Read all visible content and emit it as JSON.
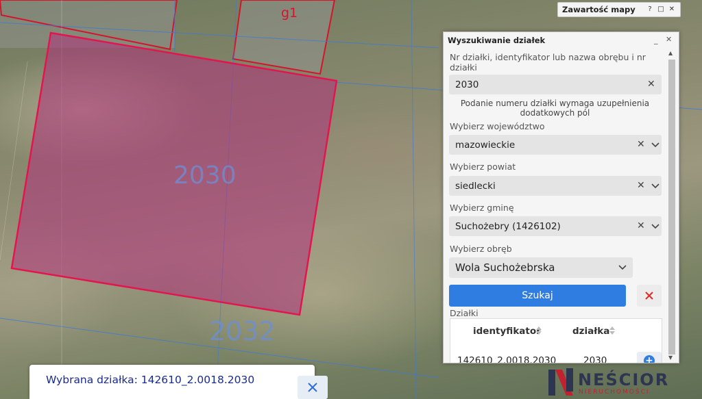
{
  "map": {
    "parcels": {
      "selected_label": "2030",
      "lower_label": "2032",
      "building_label": "g1"
    },
    "colors": {
      "parcel_border": "#e4144f",
      "parcel_fill": "#b0327a",
      "building_border": "#d4142a",
      "grid_line": "#3d7bd6",
      "label_color": "#6c8fd6"
    }
  },
  "map_contents": {
    "title": "Zawartość mapy",
    "help_label": "?",
    "restore_label": "□",
    "close_label": "✕"
  },
  "search_panel": {
    "title": "Wyszukiwanie działek",
    "minimize_label": "_",
    "close_label": "✕",
    "parcel_query": {
      "label": "Nr działki, identyfikator lub nazwa obrębu i nr działki",
      "value": "2030"
    },
    "hint": "Podanie numeru działki wymaga uzupełnienia dodatkowych pól",
    "voivodeship": {
      "label": "Wybierz województwo",
      "value": "mazowieckie"
    },
    "county": {
      "label": "Wybierz powiat",
      "value": "siedlecki"
    },
    "commune": {
      "label": "Wybierz gminę",
      "value": "Suchożebry (1426102)"
    },
    "precinct": {
      "label": "Wybierz obręb",
      "value": "Wola Suchożebrska"
    },
    "search_button": "Szukaj",
    "results": {
      "title": "Działki",
      "columns": [
        "identyfikator",
        "działka"
      ],
      "rows": [
        {
          "identyfikator": "142610_2.0018.2030",
          "dzialka": "2030"
        }
      ]
    }
  },
  "selected_parcel": {
    "text": "Wybrana działka: 142610_2.0018.2030"
  },
  "logo": {
    "name": "NEŚCIOR",
    "subtitle": "NIERUCHOMOŚCI"
  }
}
